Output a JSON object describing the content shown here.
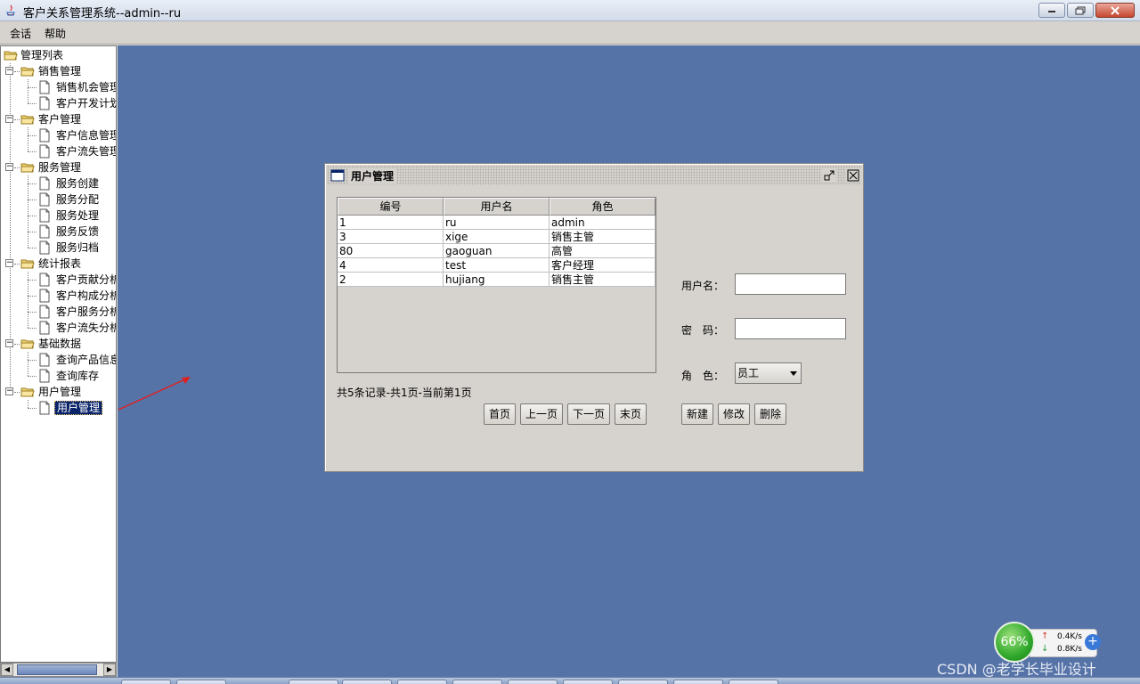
{
  "window": {
    "title": "客户关系管理系统--admin--ru"
  },
  "menubar": {
    "items": [
      "会话",
      "帮助"
    ]
  },
  "tree": {
    "root": "管理列表",
    "groups": [
      {
        "label": "销售管理",
        "children": [
          "销售机会管理",
          "客户开发计划"
        ]
      },
      {
        "label": "客户管理",
        "children": [
          "客户信息管理",
          "客户流失管理"
        ]
      },
      {
        "label": "服务管理",
        "children": [
          "服务创建",
          "服务分配",
          "服务处理",
          "服务反馈",
          "服务归档"
        ]
      },
      {
        "label": "统计报表",
        "children": [
          "客户贡献分析",
          "客户构成分析",
          "客户服务分析",
          "客户流失分析"
        ]
      },
      {
        "label": "基础数据",
        "children": [
          "查询产品信息",
          "查询库存"
        ]
      },
      {
        "label": "用户管理",
        "children": [
          "用户管理"
        ]
      }
    ],
    "selected": "用户管理"
  },
  "dialog": {
    "title": "用户管理",
    "table": {
      "columns": [
        "编号",
        "用户名",
        "角色"
      ],
      "rows": [
        [
          "1",
          "ru",
          "admin"
        ],
        [
          "3",
          "xige",
          "销售主管"
        ],
        [
          "80",
          "gaoguan",
          "高管"
        ],
        [
          "4",
          "test",
          "客户经理"
        ],
        [
          "2",
          "hujiang",
          "销售主管"
        ]
      ]
    },
    "summary": "共5条记录-共1页-当前第1页",
    "pager": {
      "first": "首页",
      "prev": "上一页",
      "next": "下一页",
      "last": "末页"
    },
    "form": {
      "username_label": "用户名：",
      "username_value": "",
      "password_label": "密　码：",
      "password_value": "",
      "role_label": "角　色：",
      "role_value": "员工"
    },
    "actions": {
      "create": "新建",
      "edit": "修改",
      "delete": "删除"
    }
  },
  "net_widget": {
    "percent": "66%",
    "up": "0.4K/s",
    "down": "0.8K/s"
  },
  "watermark": "CSDN @老学长毕业设计"
}
